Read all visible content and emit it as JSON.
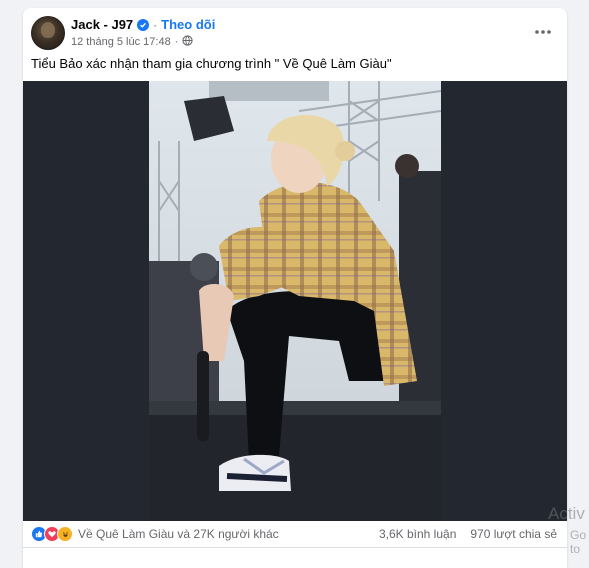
{
  "post": {
    "author": "Jack - J97",
    "follow_label": "Theo dõi",
    "timestamp": "12 tháng 5 lúc 17:48",
    "caption": "Tiểu Bảo xác nhận tham gia chương trình \" Về Quê Làm Giàu\"",
    "reactions_text": "Về Quê Làm Giàu và 27K người khác",
    "comments_text": "3,6K bình luận",
    "shares_text": "970 lượt chia sẻ"
  },
  "overlay": {
    "activate_line1": "Activ",
    "activate_line2": "Go to"
  },
  "colors": {
    "accent": "#1877f2",
    "like": "#1877f2",
    "love": "#f33e58",
    "haha": "#f7b125"
  }
}
